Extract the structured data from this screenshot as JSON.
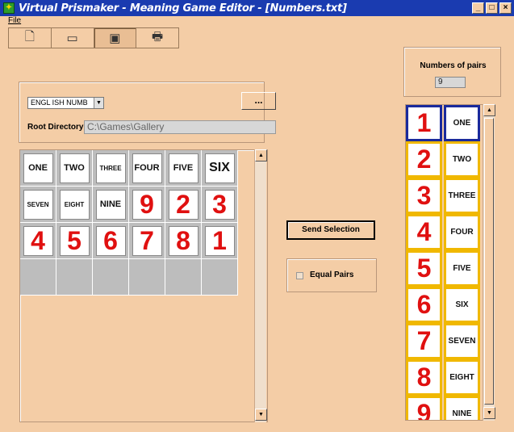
{
  "window": {
    "title": "Virtual Prismaker - Meaning Game Editor - [Numbers.txt]",
    "app_icon": "prismaker-logo-icon",
    "controls": [
      "minimize-icon",
      "maximize-icon",
      "close-icon"
    ]
  },
  "menu": {
    "file": "File"
  },
  "toolbar": {
    "buttons": [
      {
        "icon": "new-document-icon"
      },
      {
        "icon": "open-folder-icon"
      },
      {
        "icon": "save-disk-icon",
        "pressed": true
      },
      {
        "icon": "print-icon"
      }
    ]
  },
  "pairs_count": {
    "label": "Numbers of pairs",
    "value": "9"
  },
  "language": {
    "selected": "ENGL ISH NUMB",
    "more_label": "...",
    "root_label": "Root Directory",
    "root_value": "C:\\Games\\Gallery"
  },
  "grid": {
    "cells": [
      {
        "text": "ONE",
        "kind": "word"
      },
      {
        "text": "TWO",
        "kind": "word"
      },
      {
        "text": "THREE",
        "kind": "word-small"
      },
      {
        "text": "FOUR",
        "kind": "word"
      },
      {
        "text": "FIVE",
        "kind": "word"
      },
      {
        "text": "SIX",
        "kind": "word-big"
      },
      {
        "text": "SEVEN",
        "kind": "word-small"
      },
      {
        "text": "EIGHT",
        "kind": "word-small"
      },
      {
        "text": "NINE",
        "kind": "word"
      },
      {
        "text": "9",
        "kind": "num"
      },
      {
        "text": "2",
        "kind": "num"
      },
      {
        "text": "3",
        "kind": "num"
      },
      {
        "text": "4",
        "kind": "num"
      },
      {
        "text": "5",
        "kind": "num"
      },
      {
        "text": "6",
        "kind": "num"
      },
      {
        "text": "7",
        "kind": "num"
      },
      {
        "text": "8",
        "kind": "num"
      },
      {
        "text": "1",
        "kind": "num"
      },
      {
        "text": "",
        "kind": "empty"
      },
      {
        "text": "",
        "kind": "empty"
      },
      {
        "text": "",
        "kind": "empty"
      },
      {
        "text": "",
        "kind": "empty"
      },
      {
        "text": "",
        "kind": "empty"
      },
      {
        "text": "",
        "kind": "empty"
      }
    ]
  },
  "actions": {
    "send_selection": "Send Selection",
    "equal_pairs": "Equal Pairs",
    "equal_pairs_checked": false
  },
  "pairs": [
    {
      "num": "1",
      "word": "ONE",
      "selected": true
    },
    {
      "num": "2",
      "word": "TWO"
    },
    {
      "num": "3",
      "word": "THREE"
    },
    {
      "num": "4",
      "word": "FOUR"
    },
    {
      "num": "5",
      "word": "FIVE"
    },
    {
      "num": "6",
      "word": "SIX"
    },
    {
      "num": "7",
      "word": "SEVEN"
    },
    {
      "num": "8",
      "word": "EIGHT"
    },
    {
      "num": "9",
      "word": "NINE"
    }
  ]
}
